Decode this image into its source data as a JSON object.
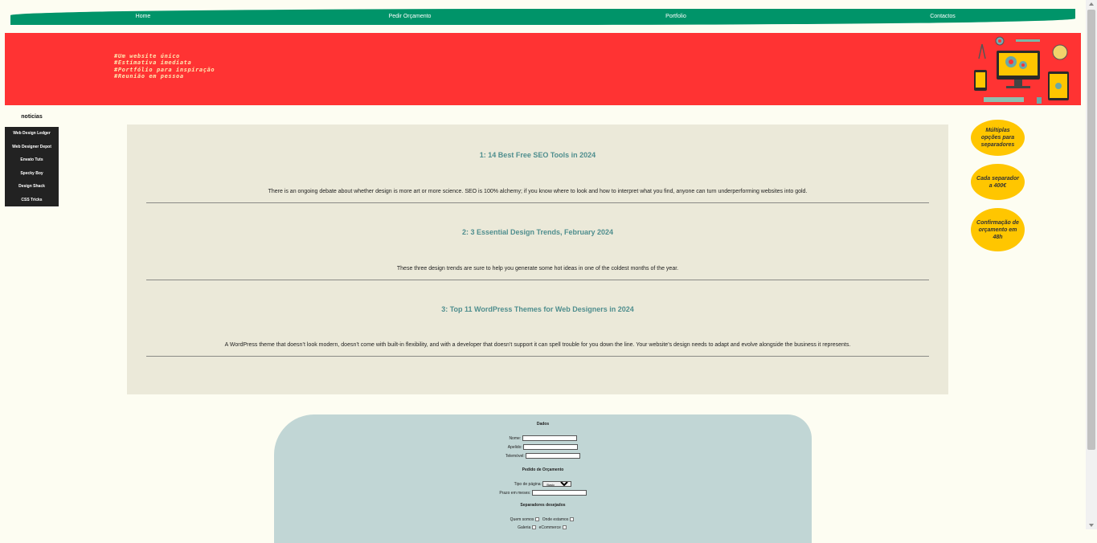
{
  "nav": {
    "items": [
      "Home",
      "Pedir Orçamento",
      "Portfolio",
      "Contactos"
    ]
  },
  "banner": {
    "taglines": [
      "#Um website único",
      "#Estimativa imediata",
      "#Portfólio para inspiração",
      "#Reunião em pessoa"
    ]
  },
  "sidebar": {
    "title": "noticias",
    "links": [
      "Web Design Ledger",
      "Web Designer Depot",
      "Envato Tuts",
      "Specky Boy",
      "Design Shack",
      "CSS Tricks"
    ]
  },
  "posts": [
    {
      "title": "1: 14 Best Free SEO Tools in 2024",
      "summary": "There is an ongoing debate about whether design is more art or more science. SEO is 100% alchemy; if you know where to look and how to interpret what you find, anyone can turn underperforming websites into gold."
    },
    {
      "title": "2: 3 Essential Design Trends, February 2024",
      "summary": "These three design trends are sure to help you generate some hot ideas in one of the coldest months of the year."
    },
    {
      "title": "3: Top 11 WordPress Themes for Web Designers in 2024",
      "summary": "A WordPress theme that doesn’t look modern, doesn’t come with built-in flexibility, and with a developer that doesn’t support it can spell trouble for you down the line. Your website’s design needs to adapt and evolve alongside the business it represents."
    }
  ],
  "bubbles": [
    "Múltiplas opções para separadores",
    "Cada separador a 400€",
    "Confirmação de orçamento em 48h"
  ],
  "form": {
    "section_data": "Dados",
    "name_label": "Nome:",
    "surname_label": "Apelido:",
    "phone_label": "Telemóvel:",
    "section_quote": "Pedido de Orçamento",
    "page_type_label": "Tipo de página:",
    "page_type_value": "Basic",
    "deadline_label": "Prazo em meses:",
    "section_separators": "Separadores desejados",
    "sep_about": "Quem somos",
    "sep_where": "Onde estamos",
    "sep_gallery": "Galeria",
    "sep_ecommerce": "eCommerce"
  },
  "colors": {
    "nav": "#009469",
    "banner": "#ff3333",
    "bubble": "#ffc600",
    "form": "#c1d6d5",
    "main": "#ebe9d9"
  }
}
